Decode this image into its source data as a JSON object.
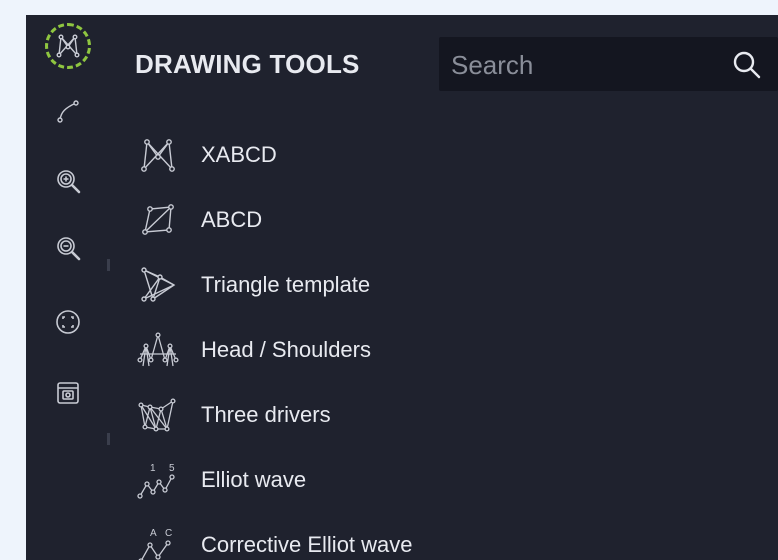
{
  "panel": {
    "title": "DRAWING TOOLS",
    "search_placeholder": "Search",
    "search_value": ""
  },
  "toolbar": {
    "items": [
      {
        "icon": "xabcd-pattern-icon",
        "active": true
      },
      {
        "icon": "trend-line-icon",
        "active": false
      },
      {
        "icon": "zoom-in-icon",
        "active": false
      },
      {
        "icon": "zoom-out-icon",
        "active": false
      },
      {
        "icon": "fit-screen-icon",
        "active": false
      },
      {
        "icon": "screenshot-icon",
        "active": false
      }
    ]
  },
  "tools": [
    {
      "label": "XABCD",
      "icon": "xabcd-icon"
    },
    {
      "label": "ABCD",
      "icon": "abcd-icon"
    },
    {
      "label": "Triangle template",
      "icon": "triangle-template-icon"
    },
    {
      "label": "Head / Shoulders",
      "icon": "head-shoulders-icon"
    },
    {
      "label": "Three drivers",
      "icon": "three-drivers-icon"
    },
    {
      "label": "Elliot wave",
      "icon": "elliot-wave-icon",
      "marks": [
        "1",
        "5"
      ]
    },
    {
      "label": "Corrective Elliot wave",
      "icon": "corrective-elliot-wave-icon",
      "marks": [
        "A",
        "C"
      ]
    }
  ],
  "colors": {
    "page_background": "#eef4fc",
    "panel_background": "#1f222e",
    "search_background": "#141620",
    "text": "#e8eaf0",
    "icon": "#c8cbd4",
    "active_ring": "#8fc640"
  }
}
